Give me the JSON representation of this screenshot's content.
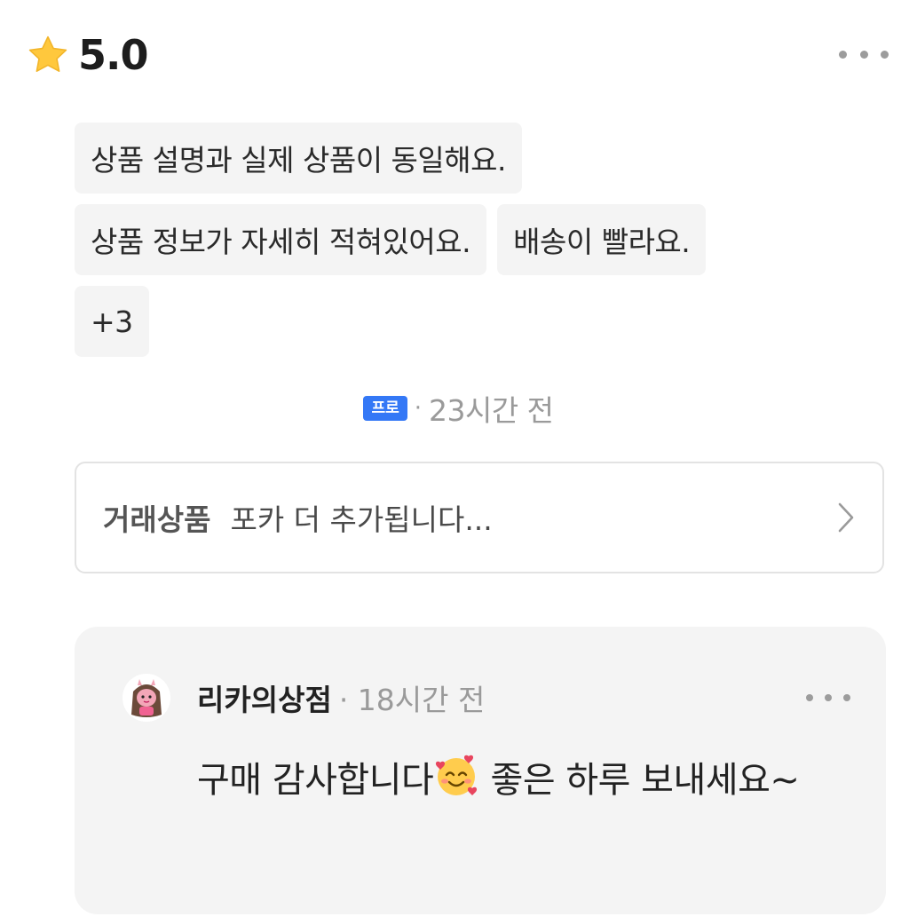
{
  "rating": {
    "icon": "star-icon",
    "value": "5.0"
  },
  "tags": [
    "상품 설명과 실제 상품이 동일해요.",
    "상품 정보가 자세히 적혀있어요.",
    "배송이 빨라요.",
    "+3"
  ],
  "meta": {
    "badge": "프로",
    "separator": "·",
    "time": "23시간 전"
  },
  "product": {
    "label": "거래상품",
    "name": "포카 더 추가됩니다..."
  },
  "reply": {
    "seller_name": "리카의상점",
    "meta": "· 18시간 전",
    "text_before": "구매 감사합니다",
    "emoji": "smiling-face-with-hearts",
    "text_after": " 좋은 하루 보내세요~"
  },
  "colors": {
    "accent_blue": "#3478f6",
    "star_yellow": "#ffc83d",
    "tag_bg": "#f4f4f4",
    "muted_text": "#9a9a9a"
  }
}
